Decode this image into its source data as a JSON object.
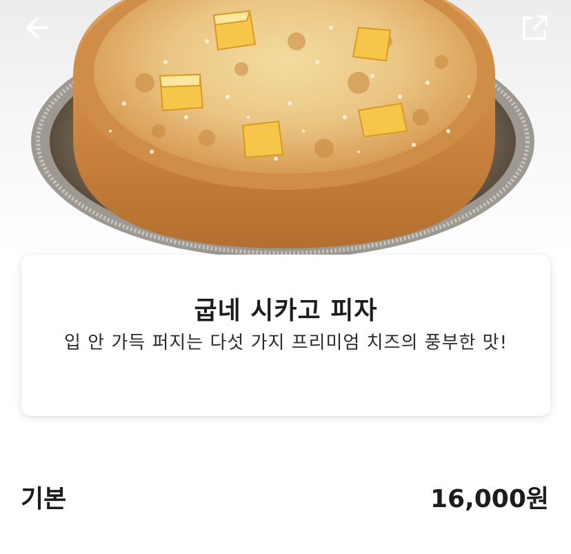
{
  "header": {
    "back_icon": "arrow-left-icon",
    "share_icon": "share-external-icon"
  },
  "hero": {
    "image": "pizza-photo"
  },
  "product": {
    "name": "굽네 시카고 피자",
    "description": "입 안 가득 퍼지는 다섯 가지 프리미엄 치즈의 풍부한 맛!"
  },
  "options": [
    {
      "label": "기본",
      "price": "16,000원"
    }
  ]
}
